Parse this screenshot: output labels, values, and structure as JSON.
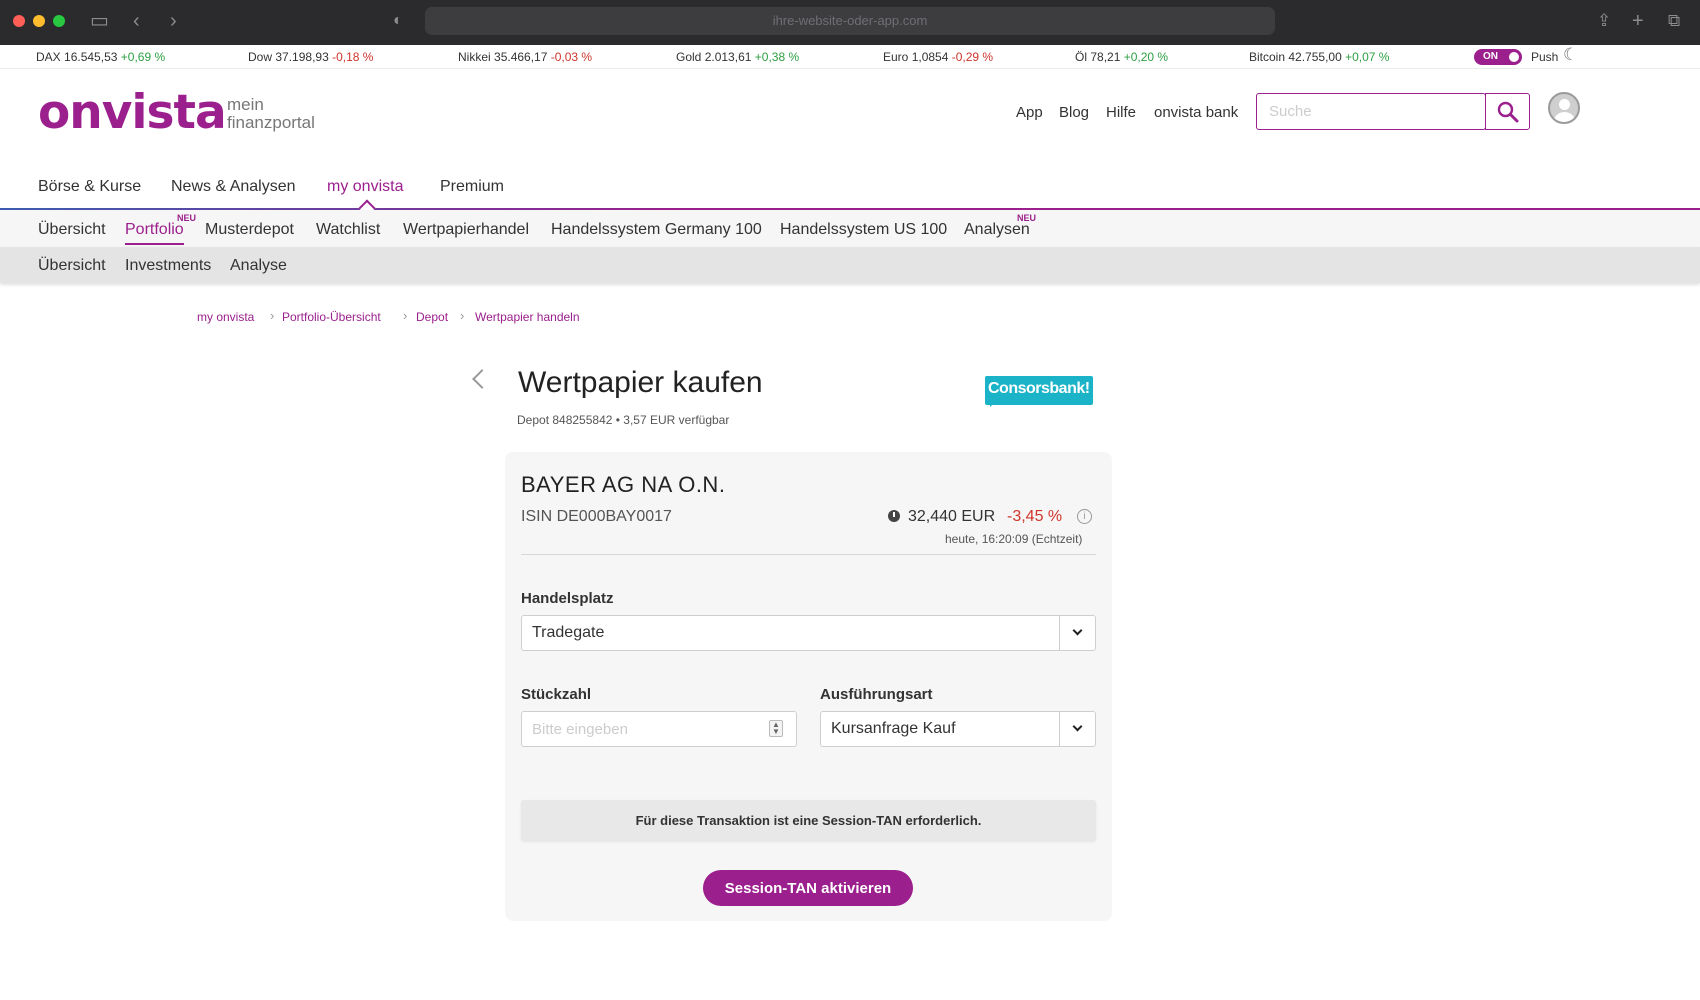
{
  "browser": {
    "url": "ihre-website-oder-app.com"
  },
  "ticker": [
    {
      "name": "DAX",
      "value": "16.545,53",
      "change": "+0,69 %",
      "dir": "pos"
    },
    {
      "name": "Dow",
      "value": "37.198,93",
      "change": "-0,18 %",
      "dir": "neg"
    },
    {
      "name": "Nikkei",
      "value": "35.466,17",
      "change": "-0,03 %",
      "dir": "neg"
    },
    {
      "name": "Gold",
      "value": "2.013,61",
      "change": "+0,38 %",
      "dir": "pos"
    },
    {
      "name": "Euro",
      "value": "1,0854",
      "change": "-0,29 %",
      "dir": "neg"
    },
    {
      "name": "Öl",
      "value": "78,21",
      "change": "+0,20 %",
      "dir": "pos"
    },
    {
      "name": "Bitcoin",
      "value": "42.755,00",
      "change": "+0,07 %",
      "dir": "pos"
    }
  ],
  "push": {
    "toggle_label": "ON",
    "label": "Push"
  },
  "header": {
    "logo": "onvista",
    "logo_sub_1": "mein",
    "logo_sub_2": "finanzportal",
    "links": [
      "App",
      "Blog",
      "Hilfe",
      "onvista bank"
    ],
    "search_placeholder": "Suche"
  },
  "main_nav": [
    "Börse & Kurse",
    "News & Analysen",
    "my onvista",
    "Premium"
  ],
  "sub_nav_1": [
    "Übersicht",
    "Portfolio",
    "Musterdepot",
    "Watchlist",
    "Wertpapierhandel",
    "Handelssystem Germany 100",
    "Handelssystem US 100",
    "Analysen"
  ],
  "badge_new": "NEU",
  "sub_nav_2": [
    "Übersicht",
    "Investments",
    "Analyse"
  ],
  "breadcrumb": [
    "my onvista",
    "Portfolio-Übersicht",
    "Depot",
    "Wertpapier handeln"
  ],
  "page": {
    "title": "Wertpapier kaufen",
    "depot_info": "Depot 848255842 • 3,57 EUR verfügbar",
    "bank_logo": "Consorsbank!"
  },
  "security": {
    "name": "BAYER AG NA O.N.",
    "isin": "ISIN DE000BAY0017",
    "price": "32,440 EUR",
    "change": "-3,45 %",
    "timestamp": "heute, 16:20:09 (Echtzeit)"
  },
  "form": {
    "venue_label": "Handelsplatz",
    "venue_value": "Tradegate",
    "quantity_label": "Stückzahl",
    "quantity_placeholder": "Bitte eingeben",
    "execution_label": "Ausführungsart",
    "execution_value": "Kursanfrage Kauf",
    "notice": "Für diese Transaktion ist eine Session-TAN erforderlich.",
    "cta": "Session-TAN aktivieren"
  },
  "colors": {
    "brand": "#9b1f8d",
    "positive": "#2ea043",
    "negative": "#d0342c",
    "bank": "#1ab3c7"
  }
}
